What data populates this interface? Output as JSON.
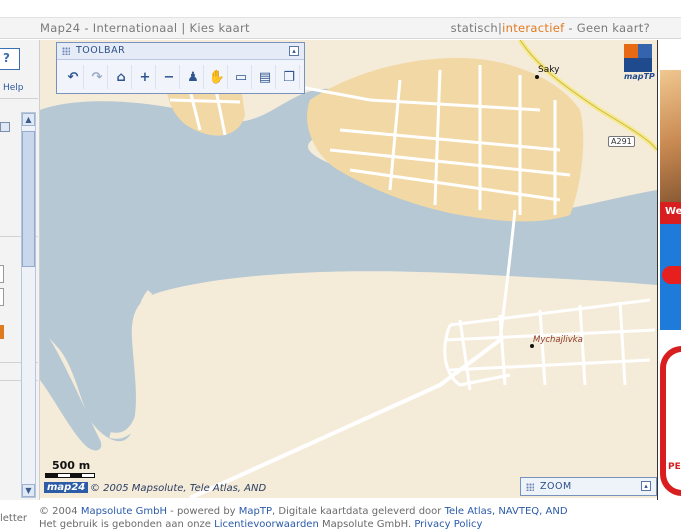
{
  "header": {
    "title": "Map24 - Internationaal",
    "sep": "|",
    "choose_map": "Kies kaart",
    "mode_static": "statisch",
    "mode_sep": "|",
    "mode_interactive": "interactief",
    "mode_dash": " - ",
    "no_map": "Geen kaart?"
  },
  "sidebar": {
    "help_icon_text": "?",
    "help_label": "Help"
  },
  "toolbar": {
    "title": "TOOLBAR",
    "minimize_glyph": "▴",
    "tools": [
      {
        "name": "undo-icon",
        "glyph": "↶"
      },
      {
        "name": "redo-icon",
        "glyph": "↷"
      },
      {
        "name": "home-icon",
        "glyph": "⌂"
      },
      {
        "name": "zoom-in-icon",
        "glyph": "+"
      },
      {
        "name": "zoom-out-icon",
        "glyph": "−"
      },
      {
        "name": "pin-icon",
        "glyph": "♟"
      },
      {
        "name": "pan-hand-icon",
        "glyph": "✋"
      },
      {
        "name": "measure-icon",
        "glyph": "▭"
      },
      {
        "name": "print-icon",
        "glyph": "▤"
      },
      {
        "name": "windows-icon",
        "glyph": "❐"
      }
    ]
  },
  "zoom_panel": {
    "title": "ZOOM",
    "maximize_glyph": "▴"
  },
  "map": {
    "scale_label": "500 m",
    "brand": "map24",
    "copyright": "© 2005 Mapsolute, Tele Atlas, AND",
    "logo_text": "mapTP",
    "place_1": "Saky",
    "place_2": "Mychajlivka",
    "road": "A291",
    "colors": {
      "water": "#b5c8d3",
      "land": "#f5ebd9",
      "town": "#f2d8a4",
      "road": "#ffffff",
      "highway": "#f6e98a"
    }
  },
  "ad": {
    "text_top": "We",
    "text_bottom": "PE"
  },
  "footer": {
    "left_fragment": "letter",
    "l1_prefix": "© 2004 ",
    "l1_link1": "Mapsolute GmbH",
    "l1_mid": " - powered by ",
    "l1_link2": "MapTP",
    "l1_mid2": ", Digitale kaartdata geleverd door ",
    "l1_link3": "Tele Atlas, NAVTEQ, AND",
    "l2_prefix": "Het gebruik is gebonden aan onze ",
    "l2_link1": "Licentievoorwaarden",
    "l2_mid": " Mapsolute GmbH. ",
    "l2_link2": "Privacy Policy"
  }
}
